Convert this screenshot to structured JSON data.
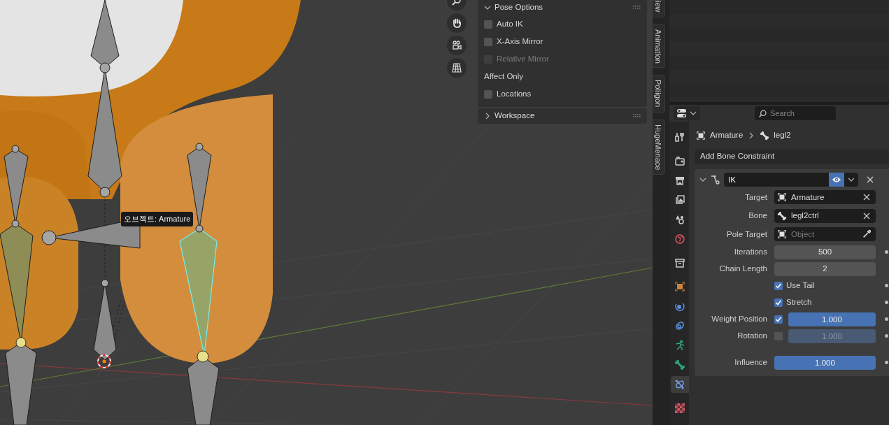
{
  "viewport": {
    "tooltip": "오브젝트: Armature"
  },
  "sidebar": {
    "panels": [
      {
        "title": "Pose Options",
        "expanded": true,
        "items": [
          {
            "kind": "checkbox",
            "label": "Auto IK",
            "checked": false,
            "disabled": false
          },
          {
            "kind": "checkbox",
            "label": "X-Axis Mirror",
            "checked": false,
            "disabled": false
          },
          {
            "kind": "checkbox",
            "label": "Relative Mirror",
            "checked": false,
            "disabled": true
          },
          {
            "kind": "heading",
            "label": "Affect Only"
          },
          {
            "kind": "checkbox",
            "label": "Locations",
            "checked": false,
            "disabled": false
          }
        ]
      },
      {
        "title": "Workspace",
        "expanded": false
      }
    ]
  },
  "sidebar_tabs": [
    {
      "label": "iew"
    },
    {
      "label": "Animation"
    },
    {
      "label": "Poliigon"
    },
    {
      "label": "HugeMenace"
    }
  ],
  "properties": {
    "search": {
      "placeholder": "Search"
    },
    "tab_groups": [
      [
        {
          "kind": "tool",
          "selected": false
        }
      ],
      [
        {
          "kind": "render",
          "selected": false
        },
        {
          "kind": "output",
          "selected": false
        },
        {
          "kind": "view_layer",
          "selected": false
        },
        {
          "kind": "scene",
          "selected": false
        },
        {
          "kind": "world",
          "selected": false
        }
      ],
      [
        {
          "kind": "collection",
          "selected": false
        }
      ],
      [
        {
          "kind": "object",
          "selected": false
        },
        {
          "kind": "physics",
          "selected": false
        },
        {
          "kind": "object_constraint",
          "selected": false
        },
        {
          "kind": "object_data",
          "selected": false
        },
        {
          "kind": "bone",
          "selected": false
        },
        {
          "kind": "bone_constraint",
          "selected": true
        }
      ],
      [
        {
          "kind": "texture",
          "selected": false
        }
      ]
    ],
    "breadcrumb": [
      "Armature",
      "legl2"
    ],
    "add_menu": "Add Bone Constraint",
    "constraint": {
      "name": "IK",
      "expanded": true,
      "enabled": true,
      "rows": [
        {
          "kind": "target_field",
          "label": "Target",
          "value": "Armature"
        },
        {
          "kind": "bone_field",
          "label": "Bone",
          "value": "legl2ctrl"
        },
        {
          "kind": "pole_field",
          "label": "Pole Target",
          "placeholder": "Object"
        },
        {
          "kind": "number",
          "label": "Iterations",
          "value": "500",
          "animatable": true
        },
        {
          "kind": "number",
          "label": "Chain Length",
          "value": "2",
          "animatable": false
        },
        {
          "kind": "checkbox",
          "label": "Use Tail",
          "checked": true,
          "animatable": true
        },
        {
          "kind": "checkbox",
          "label": "Stretch",
          "checked": true,
          "animatable": true
        },
        {
          "kind": "checkbox_slider",
          "label": "Weight Position",
          "checked": true,
          "value": "1.000",
          "level": 1,
          "animatable": true
        },
        {
          "kind": "checkbox_slider",
          "label": "Rotation",
          "checked": false,
          "value": "1.000",
          "level": 1,
          "animatable": true
        }
      ],
      "influence": {
        "label": "Influence",
        "value": "1.000",
        "level": 1,
        "animatable": true
      }
    }
  }
}
